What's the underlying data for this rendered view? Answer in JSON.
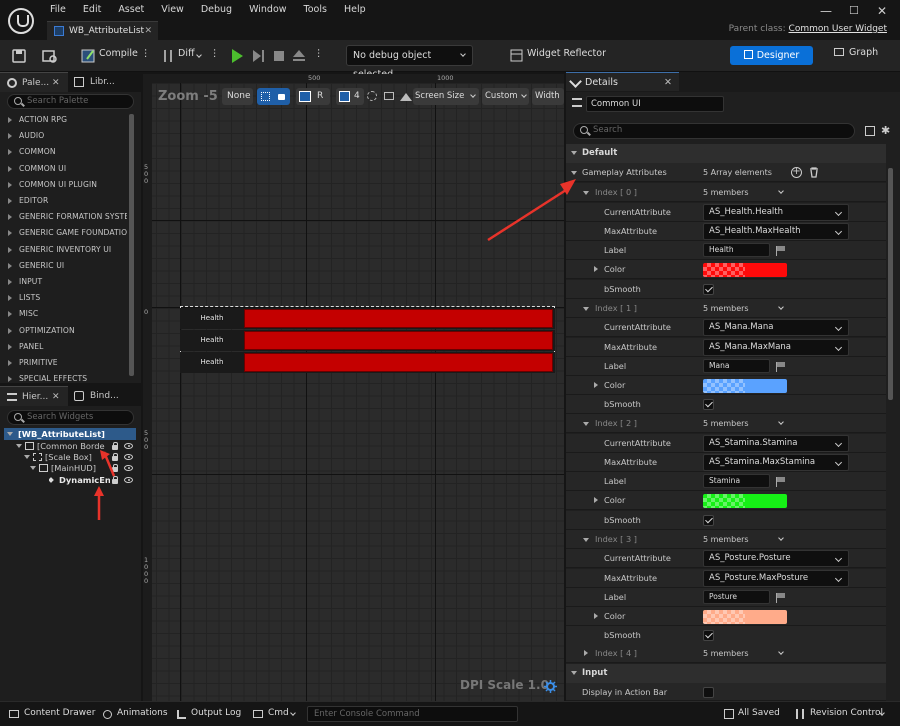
{
  "window": {
    "tab_title": "WB_AttributeList",
    "parent_label": "Parent class:",
    "parent_value": "Common User Widget"
  },
  "menu": [
    "File",
    "Edit",
    "Asset",
    "View",
    "Debug",
    "Window",
    "Tools",
    "Help"
  ],
  "toolbar": {
    "compile": "Compile",
    "diff": "Diff",
    "debug_object": "No debug object selected",
    "widget_reflector": "Widget Reflector",
    "designer": "Designer",
    "graph": "Graph"
  },
  "palette": {
    "tab1": "Pale...",
    "tab2": "Libr...",
    "search_placeholder": "Search Palette",
    "categories": [
      "ACTION RPG",
      "AUDIO",
      "COMMON",
      "COMMON UI",
      "COMMON UI PLUGIN",
      "EDITOR",
      "GENERIC FORMATION SYSTE",
      "GENERIC GAME FOUNDATION",
      "GENERIC INVENTORY UI",
      "GENERIC UI",
      "INPUT",
      "LISTS",
      "MISC",
      "OPTIMIZATION",
      "PANEL",
      "PRIMITIVE",
      "SPECIAL EFFECTS"
    ]
  },
  "hierarchy": {
    "tab1": "Hier...",
    "tab2": "Bind...",
    "search_placeholder": "Search Widgets",
    "root": "[WB_AttributeList]",
    "items": [
      "[Common Borde",
      "[Scale Box]",
      "[MainHUD]",
      "DynamicEntr"
    ]
  },
  "viewport": {
    "zoom": "Zoom -5",
    "none": "None",
    "r": "R",
    "grid_num": "4",
    "screen_size": "Screen Size",
    "custom": "Custom",
    "width": "Width",
    "dpi": "DPI Scale 1.0",
    "ruler_top": [
      "500",
      "1000"
    ],
    "ruler_left": [
      "5\n0\n0",
      "0",
      "5\n0\n0",
      "1\n0\n0\n0"
    ],
    "bars": [
      "Health",
      "Health",
      "Health"
    ]
  },
  "details": {
    "tab": "Details",
    "class_name": "Common UI",
    "search_placeholder": "Search",
    "section_default": "Default",
    "section_input": "Input",
    "array_name": "Gameplay Attributes",
    "array_count": "5 Array elements",
    "entries": [
      {
        "index": "Index [ 0 ]",
        "members": "5 members",
        "current": "AS_Health.Health",
        "max": "AS_Health.MaxHealth",
        "label": "Health",
        "color": "#ff0a0a",
        "smooth": true
      },
      {
        "index": "Index [ 1 ]",
        "members": "5 members",
        "current": "AS_Mana.Mana",
        "max": "AS_Mana.MaxMana",
        "label": "Mana",
        "color": "#5aa2ff",
        "smooth": true
      },
      {
        "index": "Index [ 2 ]",
        "members": "5 members",
        "current": "AS_Stamina.Stamina",
        "max": "AS_Stamina.MaxStamina",
        "label": "Stamina",
        "color": "#16f016",
        "smooth": true
      },
      {
        "index": "Index [ 3 ]",
        "members": "5 members",
        "current": "AS_Posture.Posture",
        "max": "AS_Posture.MaxPosture",
        "label": "Posture",
        "color": "#ffab8a",
        "smooth": true
      }
    ],
    "entry4_index": "Index [ 4 ]",
    "entry4_members": "5 members",
    "field_labels": {
      "current": "CurrentAttribute",
      "max": "MaxAttribute",
      "label": "Label",
      "color": "Color",
      "smooth": "bSmooth"
    },
    "display_action_bar": "Display in Action Bar"
  },
  "statusbar": {
    "content_drawer": "Content Drawer",
    "animations": "Animations",
    "output_log": "Output Log",
    "cmd": "Cmd",
    "console_placeholder": "Enter Console Command",
    "all_saved": "All Saved",
    "revision_control": "Revision Control"
  }
}
